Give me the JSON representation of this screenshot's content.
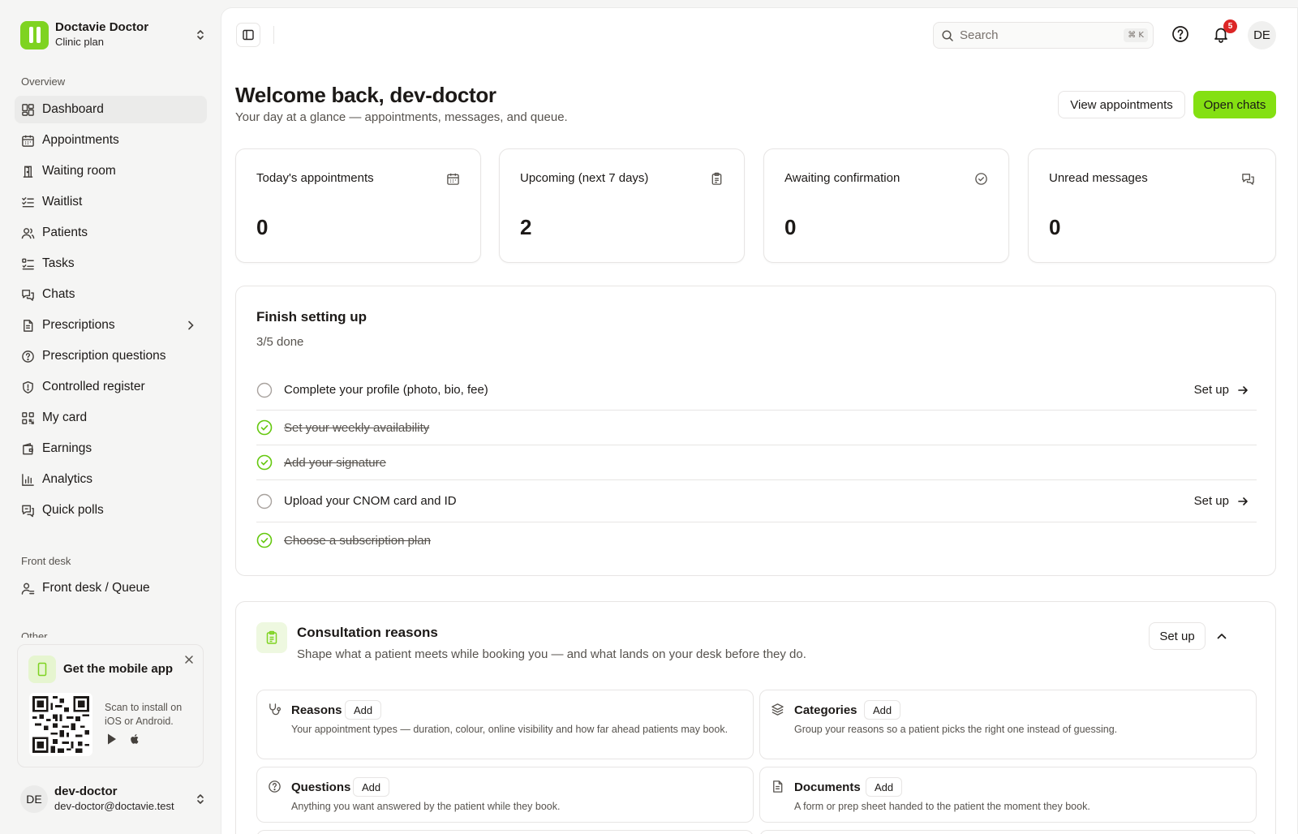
{
  "brand": {
    "name": "Doctavie Doctor",
    "plan": "Clinic plan"
  },
  "sidebar": {
    "overview_label": "Overview",
    "items": [
      {
        "label": "Dashboard",
        "icon": "dashboard-icon"
      },
      {
        "label": "Appointments",
        "icon": "calendar-icon"
      },
      {
        "label": "Waiting room",
        "icon": "door-icon"
      },
      {
        "label": "Waitlist",
        "icon": "list-checks-icon"
      },
      {
        "label": "Patients",
        "icon": "users-icon"
      },
      {
        "label": "Tasks",
        "icon": "tasks-icon"
      },
      {
        "label": "Chats",
        "icon": "chats-icon"
      },
      {
        "label": "Prescriptions",
        "icon": "file-icon"
      },
      {
        "label": "Prescription questions",
        "icon": "question-circle-icon"
      },
      {
        "label": "Controlled register",
        "icon": "shield-icon"
      },
      {
        "label": "My card",
        "icon": "qr-icon"
      },
      {
        "label": "Earnings",
        "icon": "wallet-icon"
      },
      {
        "label": "Analytics",
        "icon": "bar-chart-icon"
      },
      {
        "label": "Quick polls",
        "icon": "poll-icon"
      }
    ],
    "front_desk_label": "Front desk",
    "front_desk_items": [
      {
        "label": "Front desk / Queue",
        "icon": "user-queue-icon"
      }
    ],
    "other_label": "Other"
  },
  "mobile_app": {
    "title": "Get the mobile app",
    "description": "Scan to install on iOS or Android."
  },
  "user": {
    "initials": "DE",
    "name": "dev-doctor",
    "email": "dev-doctor@doctavie.test"
  },
  "topbar": {
    "search_placeholder": "Search",
    "search_shortcut": "⌘ K",
    "notification_count": "5",
    "avatar_initials": "DE"
  },
  "header": {
    "title": "Welcome back, dev-doctor",
    "subtitle": "Your day at a glance — appointments, messages, and queue.",
    "view_appointments": "View appointments",
    "open_chats": "Open chats"
  },
  "stats": [
    {
      "label": "Today's appointments",
      "value": "0",
      "icon": "calendar-icon"
    },
    {
      "label": "Upcoming (next 7 days)",
      "value": "2",
      "icon": "clipboard-icon"
    },
    {
      "label": "Awaiting confirmation",
      "value": "0",
      "icon": "check-circle-icon"
    },
    {
      "label": "Unread messages",
      "value": "0",
      "icon": "messages-icon"
    }
  ],
  "setup": {
    "title": "Finish setting up",
    "progress": "3/5 done",
    "action_label": "Set up",
    "tasks": [
      {
        "label": "Complete your profile (photo, bio, fee)",
        "done": false
      },
      {
        "label": "Set your weekly availability",
        "done": true
      },
      {
        "label": "Add your signature",
        "done": true
      },
      {
        "label": "Upload your CNOM card and ID",
        "done": false
      },
      {
        "label": "Choose a subscription plan",
        "done": true
      }
    ]
  },
  "consultation": {
    "title": "Consultation reasons",
    "subtitle": "Shape what a patient meets while booking you — and what lands on your desk before they do.",
    "setup_label": "Set up",
    "add_label": "Add",
    "cards": [
      {
        "title": "Reasons",
        "desc": "Your appointment types — duration, colour, online visibility and how far ahead patients may book.",
        "icon": "stethoscope-icon"
      },
      {
        "title": "Categories",
        "desc": "Group your reasons so a patient picks the right one instead of guessing.",
        "icon": "layers-icon"
      },
      {
        "title": "Questions",
        "desc": "Anything you want answered by the patient while they book.",
        "icon": "question-circle-icon"
      },
      {
        "title": "Documents",
        "desc": "A form or prep sheet handed to the patient the moment they book.",
        "icon": "document-icon"
      }
    ]
  },
  "colors": {
    "accent": "#84e012",
    "brand": "#7ed321",
    "badge": "#dc2626",
    "done_check": "#65c80f"
  }
}
